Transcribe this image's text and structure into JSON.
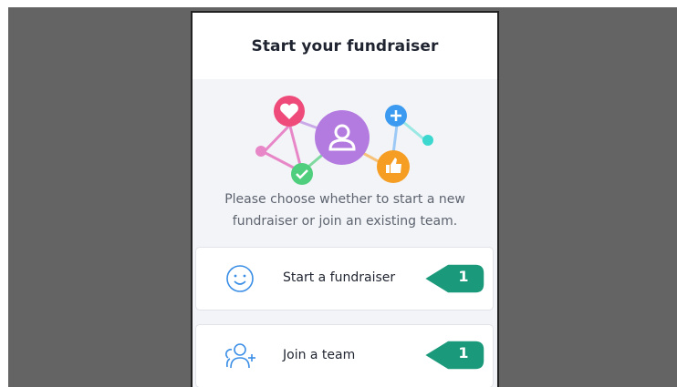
{
  "header": {
    "title": "Start your fundraiser"
  },
  "illustration": {
    "bubbles": [
      "heart-icon",
      "user-icon",
      "check-icon",
      "thumbs-up-icon",
      "plus-icon"
    ],
    "colors": {
      "heart": "#ef4b7a",
      "user": "#b37be0",
      "check": "#4fcf7d",
      "thumbs_up": "#f59e23",
      "plus": "#3c9bf0",
      "dot_pink": "#e887c8",
      "dot_teal": "#3cd8d0"
    }
  },
  "prompt": {
    "line1": "Please choose whether to start a new",
    "line2": "fundraiser or join an existing team."
  },
  "options": [
    {
      "label": "Start a fundraiser",
      "icon": "smiley-icon",
      "callout": "1"
    },
    {
      "label": "Join a team",
      "icon": "team-icon",
      "callout": "1"
    }
  ],
  "colors": {
    "backdrop": "#646464",
    "callout": "#1a9a7a",
    "icon_blue": "#3a8ee6"
  }
}
